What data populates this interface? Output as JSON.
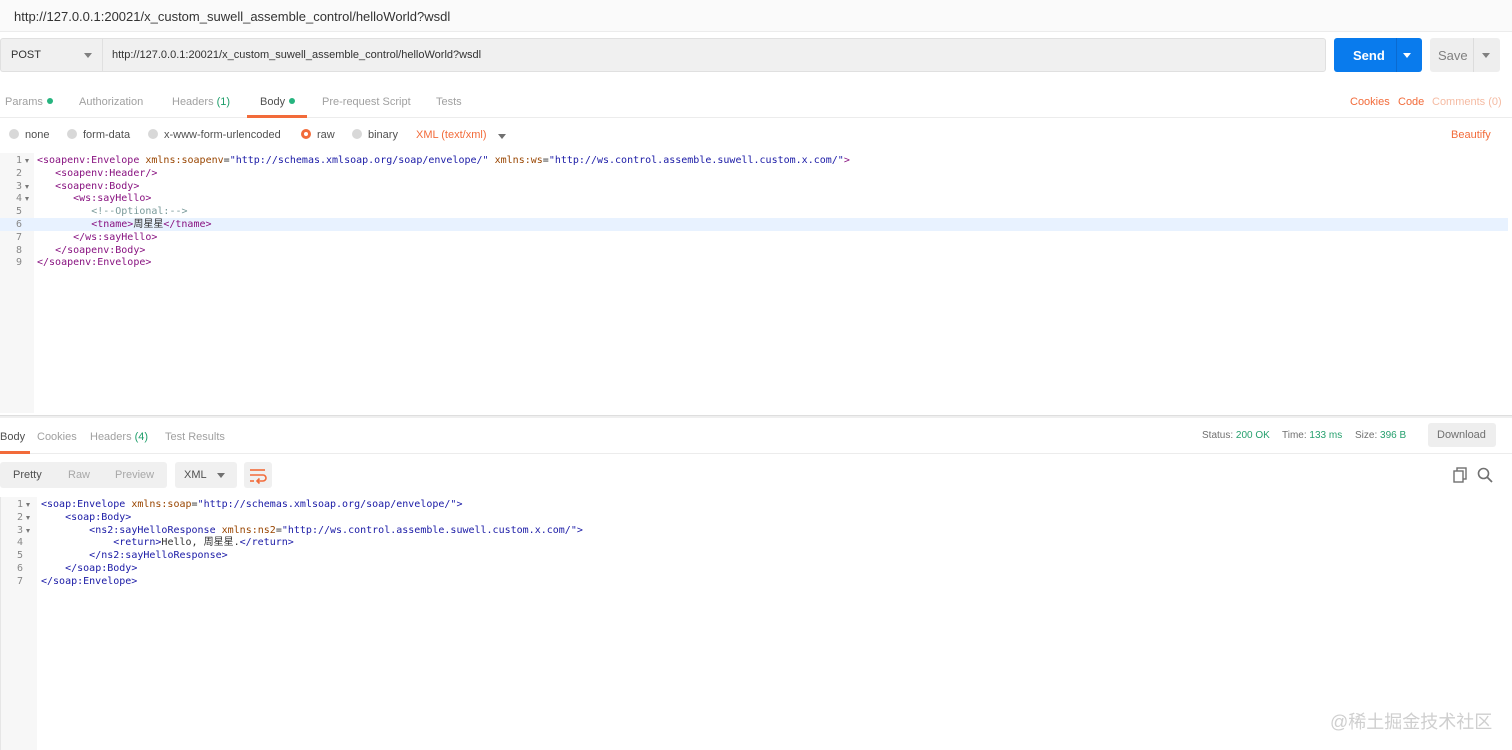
{
  "window": {
    "title": "http://127.0.0.1:20021/x_custom_suwell_assemble_control/helloWorld?wsdl"
  },
  "request": {
    "method": "POST",
    "url": "http://127.0.0.1:20021/x_custom_suwell_assemble_control/helloWorld?wsdl",
    "send_label": "Send",
    "save_label": "Save"
  },
  "tabs": {
    "params": "Params",
    "authorization": "Authorization",
    "headers": "Headers",
    "headers_count": "(1)",
    "body": "Body",
    "prerequest": "Pre-request Script",
    "tests": "Tests",
    "cookies": "Cookies",
    "code": "Code",
    "comments": "Comments (0)"
  },
  "body_types": {
    "none": "none",
    "form_data": "form-data",
    "urlencoded": "x-www-form-urlencoded",
    "raw": "raw",
    "binary": "binary",
    "selected": "raw",
    "content_type": "XML (text/xml)",
    "beautify": "Beautify"
  },
  "request_body": [
    {
      "n": "1",
      "fold": true,
      "parts": [
        [
          "t",
          "<soapenv:Envelope "
        ],
        [
          "a",
          "xmlns:soapenv"
        ],
        [
          "x",
          "="
        ],
        [
          "v",
          "\"http://schemas.xmlsoap.org/soap/envelope/\""
        ],
        [
          "x",
          " "
        ],
        [
          "a",
          "xmlns:ws"
        ],
        [
          "x",
          "="
        ],
        [
          "v",
          "\"http://ws.control.assemble.suwell.custom.x.com/\""
        ],
        [
          "t",
          ">"
        ]
      ]
    },
    {
      "n": "2",
      "fold": false,
      "parts": [
        [
          "x",
          "   "
        ],
        [
          "t",
          "<soapenv:Header/>"
        ]
      ]
    },
    {
      "n": "3",
      "fold": true,
      "parts": [
        [
          "x",
          "   "
        ],
        [
          "t",
          "<soapenv:Body>"
        ]
      ]
    },
    {
      "n": "4",
      "fold": true,
      "parts": [
        [
          "x",
          "      "
        ],
        [
          "t",
          "<ws:sayHello>"
        ]
      ]
    },
    {
      "n": "5",
      "fold": false,
      "parts": [
        [
          "x",
          "         "
        ],
        [
          "c",
          "<!--Optional:-->"
        ]
      ]
    },
    {
      "n": "6",
      "fold": false,
      "hl": true,
      "parts": [
        [
          "x",
          "         "
        ],
        [
          "t",
          "<tname>"
        ],
        [
          "x",
          "周星星"
        ],
        [
          "t",
          "</tname>"
        ]
      ]
    },
    {
      "n": "7",
      "fold": false,
      "parts": [
        [
          "x",
          "      "
        ],
        [
          "t",
          "</ws:sayHello>"
        ]
      ]
    },
    {
      "n": "8",
      "fold": false,
      "parts": [
        [
          "x",
          "   "
        ],
        [
          "t",
          "</soapenv:Body>"
        ]
      ]
    },
    {
      "n": "9",
      "fold": false,
      "parts": [
        [
          "t",
          "</soapenv:Envelope>"
        ]
      ]
    }
  ],
  "response": {
    "tabs": {
      "body": "Body",
      "cookies": "Cookies",
      "headers": "Headers",
      "headers_count": "(4)",
      "tests": "Test Results"
    },
    "status_label": "Status:",
    "status_value": "200 OK",
    "time_label": "Time:",
    "time_value": "133 ms",
    "size_label": "Size:",
    "size_value": "396 B",
    "download": "Download",
    "view": {
      "pretty": "Pretty",
      "raw": "Raw",
      "preview": "Preview",
      "format": "XML"
    }
  },
  "response_body": [
    {
      "n": "1",
      "fold": true,
      "parts": [
        [
          "t",
          "<soap:Envelope "
        ],
        [
          "a",
          "xmlns:soap"
        ],
        [
          "x",
          "="
        ],
        [
          "v",
          "\"http://schemas.xmlsoap.org/soap/envelope/\""
        ],
        [
          "t",
          ">"
        ]
      ]
    },
    {
      "n": "2",
      "fold": true,
      "parts": [
        [
          "x",
          "    "
        ],
        [
          "t",
          "<soap:Body>"
        ]
      ]
    },
    {
      "n": "3",
      "fold": true,
      "parts": [
        [
          "x",
          "        "
        ],
        [
          "t",
          "<ns2:sayHelloResponse "
        ],
        [
          "a",
          "xmlns:ns2"
        ],
        [
          "x",
          "="
        ],
        [
          "v",
          "\"http://ws.control.assemble.suwell.custom.x.com/\""
        ],
        [
          "t",
          ">"
        ]
      ]
    },
    {
      "n": "4",
      "fold": false,
      "parts": [
        [
          "x",
          "            "
        ],
        [
          "t",
          "<return>"
        ],
        [
          "x",
          "Hello, 周星星."
        ],
        [
          "t",
          "</return>"
        ]
      ]
    },
    {
      "n": "5",
      "fold": false,
      "parts": [
        [
          "x",
          "        "
        ],
        [
          "t",
          "</ns2:sayHelloResponse>"
        ]
      ]
    },
    {
      "n": "6",
      "fold": false,
      "parts": [
        [
          "x",
          "    "
        ],
        [
          "t",
          "</soap:Body>"
        ]
      ]
    },
    {
      "n": "7",
      "fold": false,
      "parts": [
        [
          "t",
          "</soap:Envelope>"
        ]
      ]
    }
  ],
  "watermark": "@稀土掘金技术社区",
  "colors": {
    "accent": "#f26b3a",
    "send": "#097bed",
    "ok": "#26a06e"
  }
}
